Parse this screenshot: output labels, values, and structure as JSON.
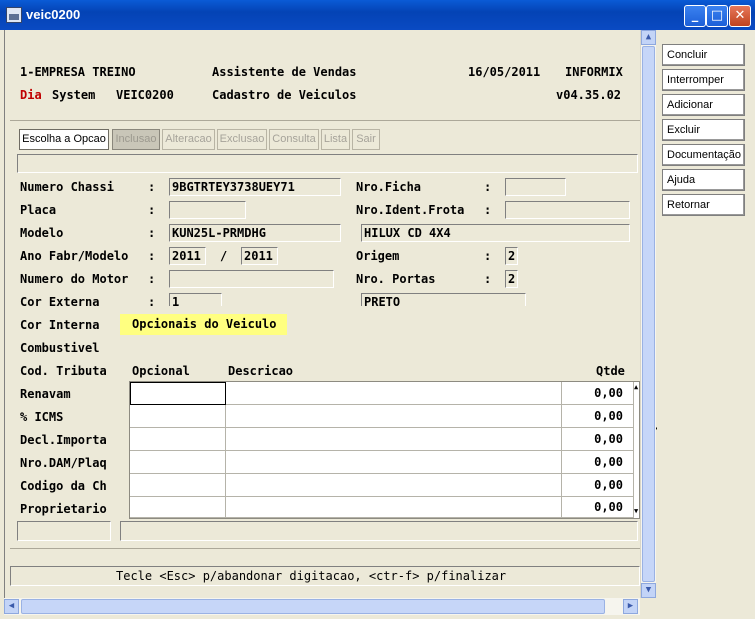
{
  "window": {
    "title": "veic0200"
  },
  "header": {
    "company": "1-EMPRESA TREINO",
    "assistant": "Assistente de Vendas",
    "date": "16/05/2011",
    "db": "INFORMIX",
    "dia": "Dia",
    "system": "System",
    "program": "VEIC0200",
    "screen": "Cadastro de Veiculos",
    "version": "v04.35.02"
  },
  "tabs": [
    {
      "label": "Escolha a Opcao"
    },
    {
      "label": "Inclusao"
    },
    {
      "label": "Alteracao"
    },
    {
      "label": "Exclusao"
    },
    {
      "label": "Consulta"
    },
    {
      "label": "Lista"
    },
    {
      "label": "Sair"
    }
  ],
  "side_buttons": [
    {
      "label": "Concluir"
    },
    {
      "label": "Interromper"
    },
    {
      "label": "Adicionar"
    },
    {
      "label": "Excluir"
    },
    {
      "label": "Documentação"
    },
    {
      "label": "Ajuda"
    },
    {
      "label": "Retornar"
    }
  ],
  "form": {
    "chassi_label": "Numero Chassi",
    "chassi_value": "9BGTRTEY3738UEY71",
    "ficha_label": "Nro.Ficha",
    "placa_label": "Placa",
    "frota_label": "Nro.Ident.Frota",
    "modelo_label": "Modelo",
    "modelo_code": "KUN25L-PRMDHG",
    "modelo_desc": "HILUX CD 4X4",
    "ano_label": "Ano Fabr/Modelo",
    "ano_fabr": "2011",
    "ano_sep": "/",
    "ano_modelo": "2011",
    "origem_label": "Origem",
    "origem_value": "2",
    "motor_label": "Numero do Motor",
    "portas_label": "Nro. Portas",
    "portas_value": "2",
    "cor_ext_label": "Cor Externa",
    "cor_ext_code": "1",
    "cor_ext_desc": "PRETO",
    "cor_int_label": "Cor Interna",
    "combustivel_label": "Combustivel",
    "cod_tribut_label": "Cod. Tributa",
    "renavam_label": "Renavam",
    "icms_label": "% ICMS",
    "decl_label": "Decl.Importa",
    "dam_label": "Nro.DAM/Plaq",
    "codigo_label": "Codigo da Ch",
    "propr_label": "Proprietario",
    "colon": ":"
  },
  "opcionais": {
    "title": "Opcionais do Veiculo",
    "col_opcional": "Opcional",
    "col_descricao": "Descricao",
    "col_qtde": "Qtde",
    "rows": [
      {
        "opcional": "",
        "descricao": "",
        "qtde": "0,00"
      },
      {
        "opcional": "",
        "descricao": "",
        "qtde": "0,00"
      },
      {
        "opcional": "",
        "descricao": "",
        "qtde": "0,00"
      },
      {
        "opcional": "",
        "descricao": "",
        "qtde": "0,00"
      },
      {
        "opcional": "",
        "descricao": "",
        "qtde": "0,00"
      },
      {
        "opcional": "",
        "descricao": "",
        "qtde": "0,00"
      }
    ]
  },
  "status": {
    "message": "Tecle <Esc> p/abandonar digitacao, <ctr-f> p/finalizar"
  },
  "colors": {
    "title_bar": "#0a5bd6",
    "dia": "#c00000",
    "panel_title_bg": "#ffff80"
  }
}
